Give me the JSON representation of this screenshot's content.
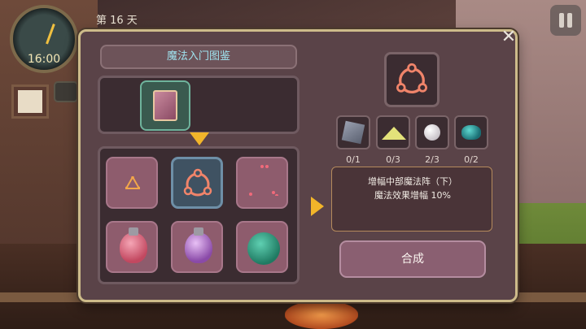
{
  "hud": {
    "clock_time": "16:00",
    "day_label": "第 16 天"
  },
  "panel": {
    "title": "魔法入门图鉴",
    "close_glyph": "✕",
    "grid_items": [
      {
        "name": "triangle-rune"
      },
      {
        "name": "magic-circle-rune"
      },
      {
        "name": "dots-rune"
      },
      {
        "name": "red-potion"
      },
      {
        "name": "purple-potion"
      },
      {
        "name": "green-orb"
      }
    ],
    "materials": [
      {
        "name": "stone-tile",
        "count": "0/1"
      },
      {
        "name": "yellow-powder",
        "count": "0/3"
      },
      {
        "name": "pearl",
        "count": "2/3"
      },
      {
        "name": "teal-gem",
        "count": "0/2"
      }
    ],
    "description": {
      "line1": "增幅中部魔法阵（下）",
      "line2": "魔法效果增幅 10%"
    },
    "craft_label": "合成"
  },
  "colors": {
    "accent": "#f2b52a",
    "title_text": "#9fe3ef",
    "rune": "#f0846a"
  }
}
